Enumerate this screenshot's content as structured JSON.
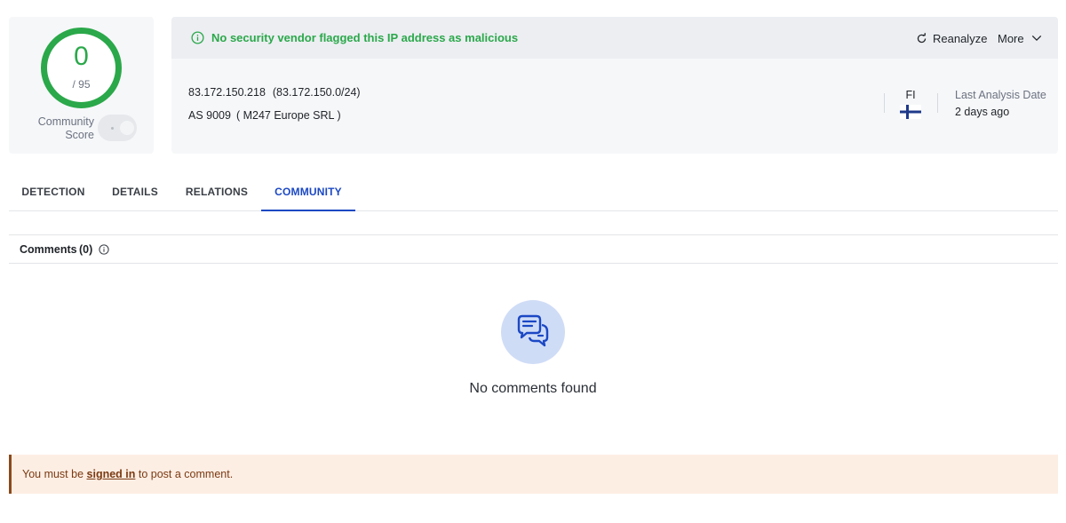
{
  "score": {
    "value": "0",
    "total": "/ 95",
    "community_label_line1": "Community",
    "community_label_line2": "Score",
    "ring_color": "#2ba84a"
  },
  "banner": {
    "icon": "info-circle-icon",
    "message": "No security vendor flagged this IP address as malicious",
    "message_color": "#2ba84a",
    "reanalyze_label": "Reanalyze",
    "more_label": "More"
  },
  "ip_info": {
    "ip": "83.172.150.218",
    "range": "(83.172.150.0/24)",
    "as_number": "AS 9009",
    "as_org": "( M247 Europe SRL )",
    "country_code": "FI",
    "flag_icon": "finland-flag-icon",
    "last_analysis_label": "Last Analysis Date",
    "last_analysis_value": "2 days ago"
  },
  "tabs": [
    {
      "label": "DETECTION",
      "active": false
    },
    {
      "label": "DETAILS",
      "active": false
    },
    {
      "label": "RELATIONS",
      "active": false
    },
    {
      "label": "COMMUNITY",
      "active": true
    }
  ],
  "comments": {
    "title": "Comments",
    "count": "(0)",
    "empty_message": "No comments found",
    "empty_icon": "chat-bubbles-icon"
  },
  "signin_notice": {
    "prefix": "You must be ",
    "link_label": "signed in",
    "suffix": " to post a comment."
  },
  "colors": {
    "accent": "#1b48c4",
    "success": "#2ba84a",
    "notice_bg": "#fdeee4",
    "notice_text": "#7a3a12"
  }
}
